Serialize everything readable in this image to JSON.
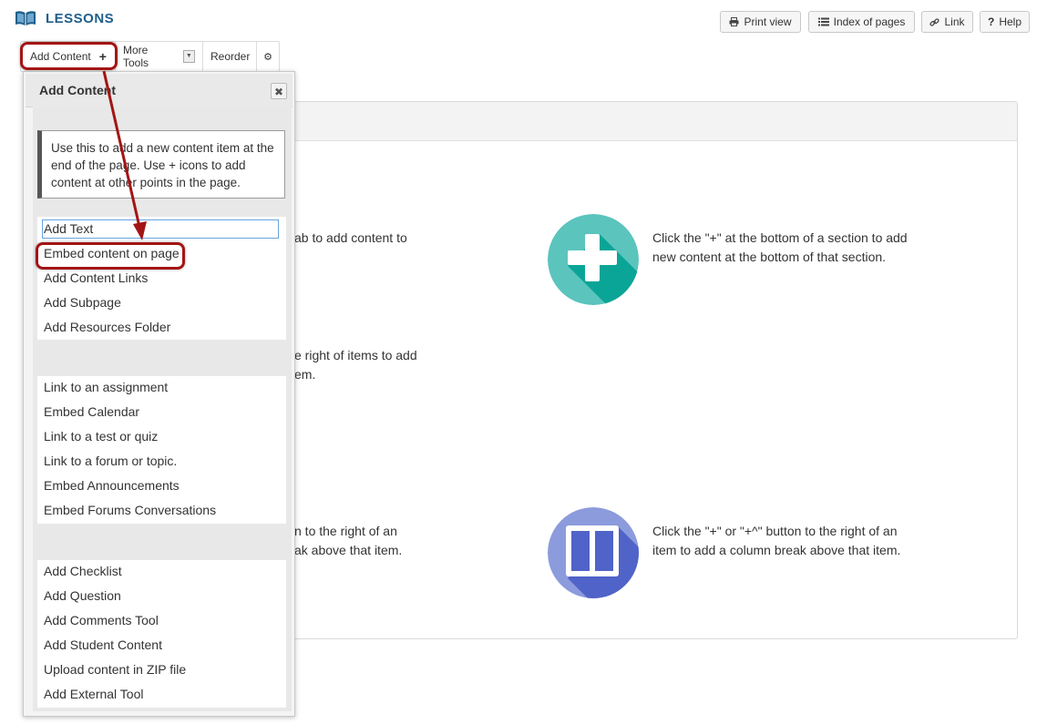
{
  "header": {
    "title": "LESSONS",
    "buttons": {
      "print": "Print view",
      "index": "Index of pages",
      "link": "Link",
      "help": "Help"
    }
  },
  "toolbar": {
    "add_content": "Add Content",
    "more_tools": "More Tools",
    "reorder": "Reorder"
  },
  "panel": {
    "text1_line1": "ab to add content to",
    "text2_line1": "Click the \"+\" at the bottom of a section to add",
    "text2_line2": "new content at the bottom of that section.",
    "text3_line1": "e right of items to add",
    "text3_line2": "em.",
    "text4_line1": "n to the right of an",
    "text4_line2": "ak above that item.",
    "text5_line1": "Click the \"+\" or \"+^\" button to the right of an",
    "text5_line2": "item to add a column break above that item.",
    "colors": {
      "plus_icon_bg": "#5bc4bd",
      "plus_icon_shadow": "#0aa597",
      "column_icon_bg": "#8c9bdc",
      "column_icon_shadow": "#5063c8"
    }
  },
  "dropdown": {
    "title": "Add Content",
    "note": "Use this to add a new content item at the end of the page. Use + icons to add content at other points in the page.",
    "group1": [
      "Add Text",
      "Embed content on page",
      "Add Content Links",
      "Add Subpage",
      "Add Resources Folder"
    ],
    "group2": [
      "Link to an assignment",
      "Embed Calendar",
      "Link to a test or quiz",
      "Link to a forum or topic.",
      "Embed Announcements",
      "Embed Forums Conversations"
    ],
    "group3": [
      "Add Checklist",
      "Add Question",
      "Add Comments Tool",
      "Add Student Content",
      "Upload content in ZIP file",
      "Add External Tool"
    ]
  },
  "annotation": {
    "highlight_color": "#a31515"
  }
}
